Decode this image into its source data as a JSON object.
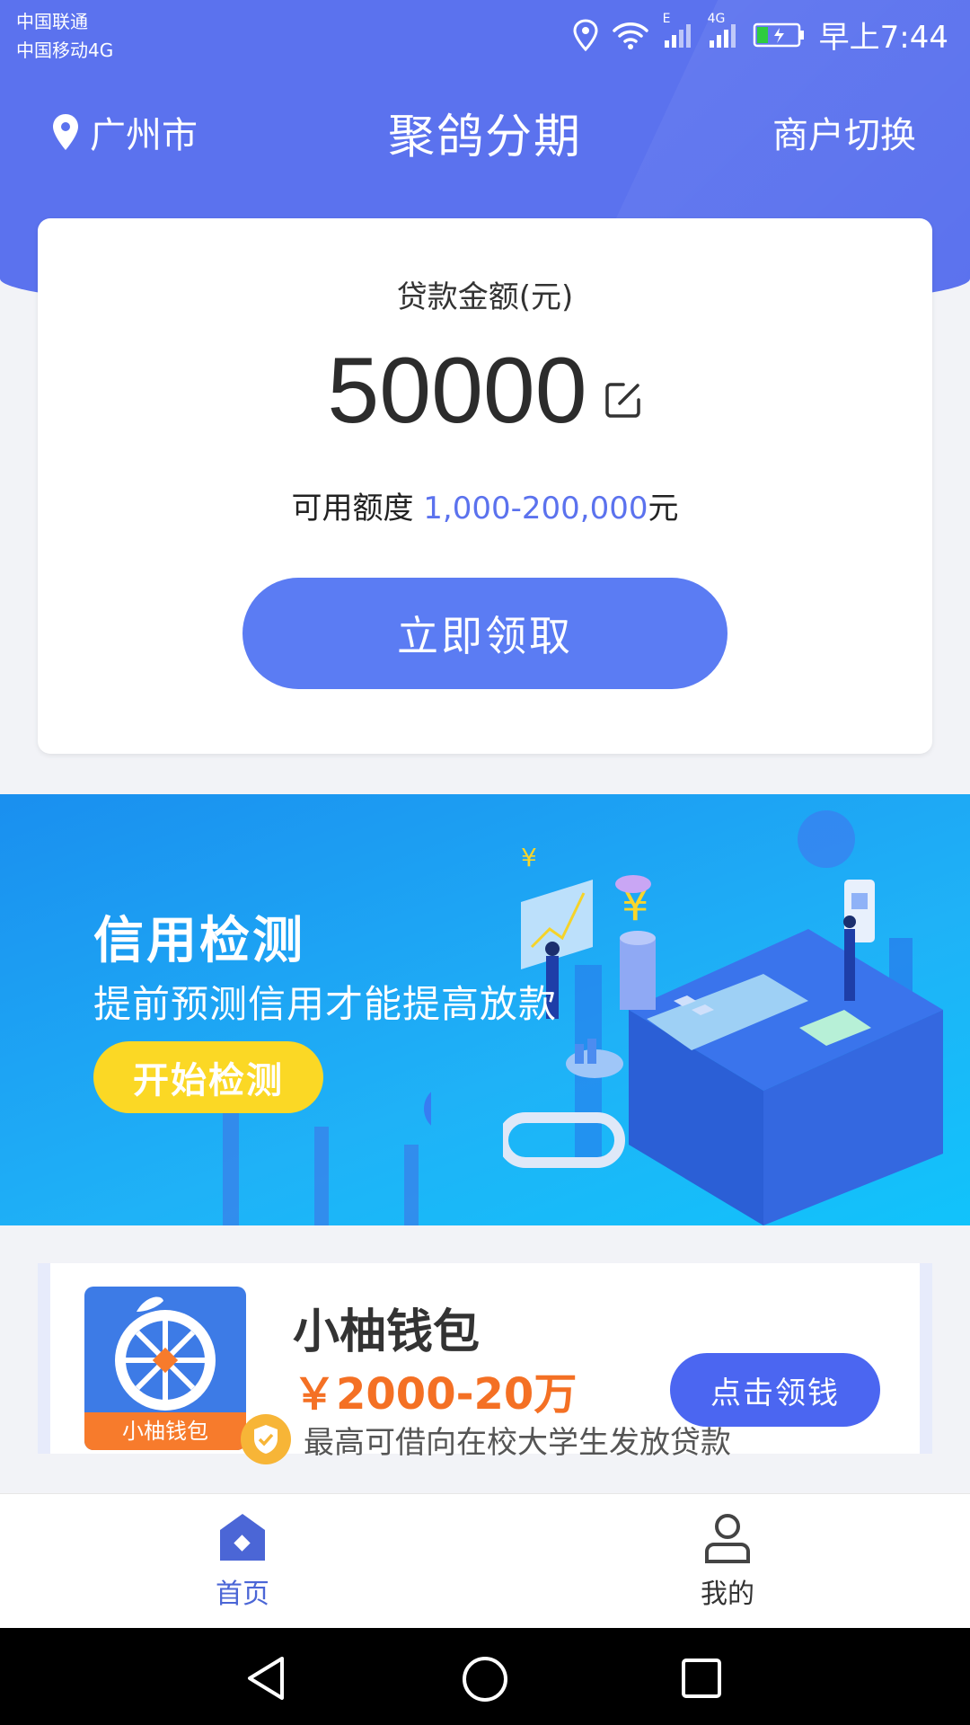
{
  "status_bar": {
    "carrier1": "中国联通",
    "carrier2": "中国移动4G",
    "network_e": "E",
    "network_4g": "4G",
    "time": "早上7:44"
  },
  "header": {
    "location": "广州市",
    "title": "聚鸽分期",
    "switch_label": "商户切换",
    "bg_color": "#5b72ee"
  },
  "loan_card": {
    "label": "贷款金额(元)",
    "amount": "50000",
    "quota_prefix": "可用额度 ",
    "quota_range": "1,000-200,000",
    "quota_suffix": "元",
    "cta_label": "立即领取",
    "accent": "#5b7cf3"
  },
  "banner": {
    "title": "信用检测",
    "subtitle": "提前预测信用才能提高放款",
    "button_label": "开始检测"
  },
  "product": {
    "logo_text": "小柚钱包",
    "name": "小柚钱包",
    "range": "￥2000-20万",
    "button_label": "点击领钱",
    "note": "最高可借向在校大学生发放贷款"
  },
  "tabbar": {
    "items": [
      {
        "label": "首页",
        "icon": "home-icon",
        "active": true
      },
      {
        "label": "我的",
        "icon": "user-icon",
        "active": false
      }
    ],
    "active_color": "#4b66d6"
  },
  "navbar": {
    "icons": [
      "back-triangle-icon",
      "home-circle-icon",
      "recents-square-icon"
    ]
  }
}
